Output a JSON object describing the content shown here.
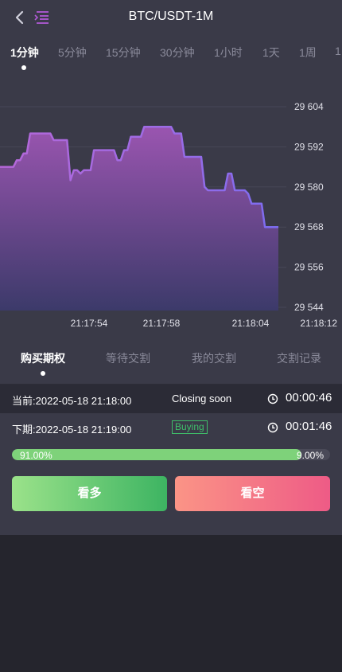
{
  "header": {
    "title": "BTC/USDT-1M",
    "back_icon": "chevron-left-icon",
    "menu_icon": "menu-indent-icon"
  },
  "periods": [
    {
      "label": "1分钟",
      "active": true
    },
    {
      "label": "5分钟",
      "active": false
    },
    {
      "label": "15分钟",
      "active": false
    },
    {
      "label": "30分钟",
      "active": false
    },
    {
      "label": "1小时",
      "active": false
    },
    {
      "label": "1天",
      "active": false
    },
    {
      "label": "1周",
      "active": false
    },
    {
      "label": "1",
      "active": false
    }
  ],
  "chart_data": {
    "type": "area",
    "y_ticks": [
      "29 604",
      "29 592",
      "29 580",
      "29 568",
      "29 556",
      "29 544"
    ],
    "y_tick_values": [
      29604,
      29592,
      29580,
      29568,
      29556,
      29544
    ],
    "x_ticks": [
      "21:17:54",
      "21:17:58",
      "21:18:04",
      "21:18:12"
    ],
    "ylim": [
      29544,
      29604
    ],
    "grid": true,
    "line_color": "#7b6cf0",
    "fill_top_color": "#9a55b0",
    "fill_bottom_color": "#3c3a6a",
    "series": [
      {
        "values": [
          29586,
          29586,
          29586,
          29586,
          29586,
          29588,
          29588,
          29590,
          29590,
          29596,
          29596,
          29596,
          29596,
          29596,
          29596,
          29596,
          29594,
          29594,
          29594,
          29594,
          29594,
          29582,
          29585,
          29585,
          29584,
          29585,
          29585,
          29585,
          29591,
          29591,
          29591,
          29591,
          29591,
          29591,
          29591,
          29588,
          29588,
          29591,
          29591,
          29595,
          29595,
          29595,
          29595,
          29598,
          29598,
          29598,
          29598,
          29598,
          29598,
          29598,
          29598,
          29598,
          29596,
          29596,
          29596,
          29589,
          29589,
          29589,
          29589,
          29589,
          29589,
          29580,
          29579,
          29579,
          29579,
          29579,
          29579,
          29579,
          29584,
          29584,
          29579,
          29579,
          29579,
          29579,
          29578,
          29575,
          29575,
          29575,
          29575,
          29568,
          29568,
          29568,
          29568,
          29568
        ]
      }
    ]
  },
  "trade_tabs": [
    {
      "label": "购买期权",
      "active": true
    },
    {
      "label": "等待交割",
      "active": false
    },
    {
      "label": "我的交割",
      "active": false
    },
    {
      "label": "交割记录",
      "active": false
    }
  ],
  "current": {
    "label": "当前:",
    "time": "2022-05-18 21:18:00",
    "status": "Closing soon",
    "countdown": "00:00:46"
  },
  "next": {
    "label": "下期:",
    "time": "2022-05-18 21:19:00",
    "status": "Buying",
    "countdown": "00:01:46"
  },
  "progress": {
    "up_percent": 91,
    "up_label": "91.00%",
    "down_label": "9.00%",
    "up_color": "#7ed27a"
  },
  "buttons": {
    "up_label": "看多",
    "down_label": "看空"
  },
  "colors": {
    "bg_dark": "#25252d",
    "panel": "#3a3a48",
    "accent_menu": "#b05ad6",
    "buying_green": "#3fbf6a"
  }
}
